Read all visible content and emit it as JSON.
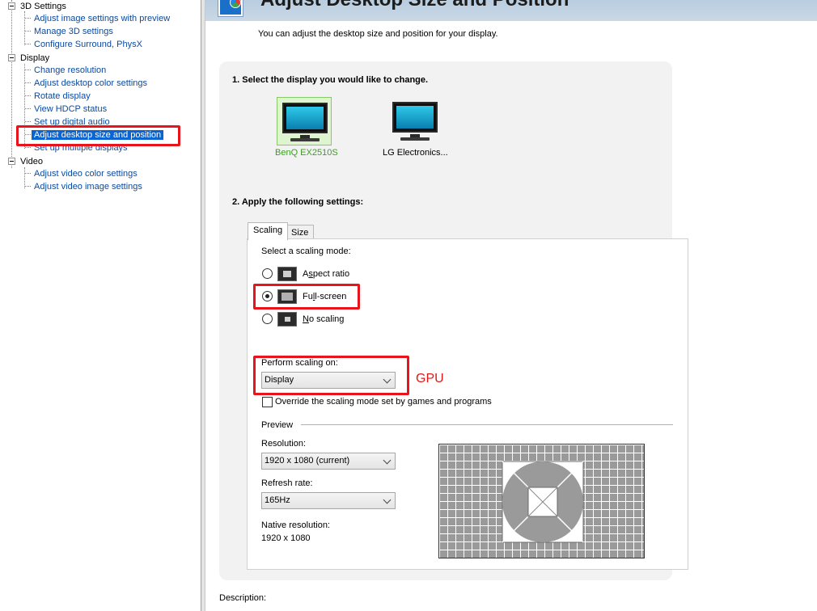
{
  "tree": {
    "categories": [
      {
        "label": "3D Settings",
        "children": [
          "Adjust image settings with preview",
          "Manage 3D settings",
          "Configure Surround, PhysX"
        ]
      },
      {
        "label": "Display",
        "children": [
          "Change resolution",
          "Adjust desktop color settings",
          "Rotate display",
          "View HDCP status",
          "Set up digital audio",
          "Adjust desktop size and position",
          "Set up multiple displays"
        ]
      },
      {
        "label": "Video",
        "children": [
          "Adjust video color settings",
          "Adjust video image settings"
        ]
      }
    ],
    "selected": "Adjust desktop size and position"
  },
  "header": {
    "title": "Adjust Desktop Size and Position",
    "subtitle": "You can adjust the desktop size and position for your display."
  },
  "step1": {
    "heading": "1. Select the display you would like to change.",
    "displays": [
      {
        "label": "BenQ EX2510S",
        "selected": true
      },
      {
        "label": "LG Electronics..."
      }
    ]
  },
  "step2": {
    "heading": "2. Apply the following settings:",
    "tabs": [
      "Scaling",
      "Size"
    ],
    "active_tab": "Scaling",
    "scaling_mode_label": "Select a scaling mode:",
    "modes": [
      {
        "label": "Aspect ratio",
        "mnemonic_index": 1
      },
      {
        "label": "Full-screen",
        "mnemonic_index": 2,
        "checked": true
      },
      {
        "label": "No scaling",
        "mnemonic_index": 0
      }
    ],
    "perform_label": "Perform scaling on:",
    "perform_value": "Display",
    "override_label": "Override the scaling mode set by games and programs",
    "override_checked": false,
    "preview_label": "Preview",
    "resolution_label": "Resolution:",
    "resolution_value": "1920 x 1080 (current)",
    "refresh_label": "Refresh rate:",
    "refresh_value": "165Hz",
    "native_label": "Native resolution:",
    "native_value": "1920 x 1080"
  },
  "annotation": {
    "gpu_text": "GPU",
    "color": "#e01818"
  },
  "description_label": "Description:"
}
